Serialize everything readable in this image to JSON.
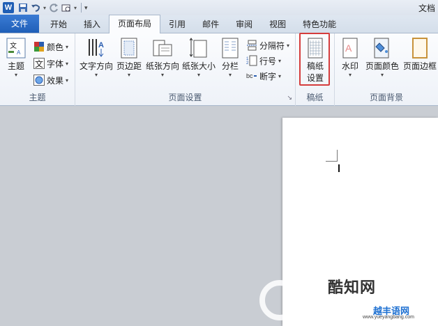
{
  "window": {
    "doc_title": "文档"
  },
  "qat": {
    "icons": [
      "word-logo-icon",
      "save-icon",
      "undo-icon",
      "redo-icon",
      "print-preview-icon",
      "customize-icon"
    ]
  },
  "tabs": [
    {
      "label": "文件"
    },
    {
      "label": "开始"
    },
    {
      "label": "插入"
    },
    {
      "label": "页面布局"
    },
    {
      "label": "引用"
    },
    {
      "label": "邮件"
    },
    {
      "label": "审阅"
    },
    {
      "label": "视图"
    },
    {
      "label": "特色功能"
    }
  ],
  "ribbon": {
    "theme_group": {
      "label": "主题",
      "themes_button": "主题",
      "colors": "颜色",
      "fonts": "字体",
      "effects": "效果"
    },
    "page_setup_group": {
      "label": "页面设置",
      "text_direction": "文字方向",
      "margins": "页边距",
      "orientation": "纸张方向",
      "size": "纸张大小",
      "columns": "分栏",
      "breaks": "分隔符",
      "line_numbers": "行号",
      "hyphenation": "断字"
    },
    "draft_group": {
      "label": "稿纸",
      "draft_settings_line1": "稿纸",
      "draft_settings_line2": "设置"
    },
    "page_background_group": {
      "label": "页面背景",
      "watermark": "水印",
      "page_color": "页面颜色",
      "page_borders": "页面边框"
    }
  },
  "watermark": {
    "brand_cn": "酷知网",
    "site_cn": "越丰语网",
    "site_url": "www.yueyangbang.com"
  }
}
